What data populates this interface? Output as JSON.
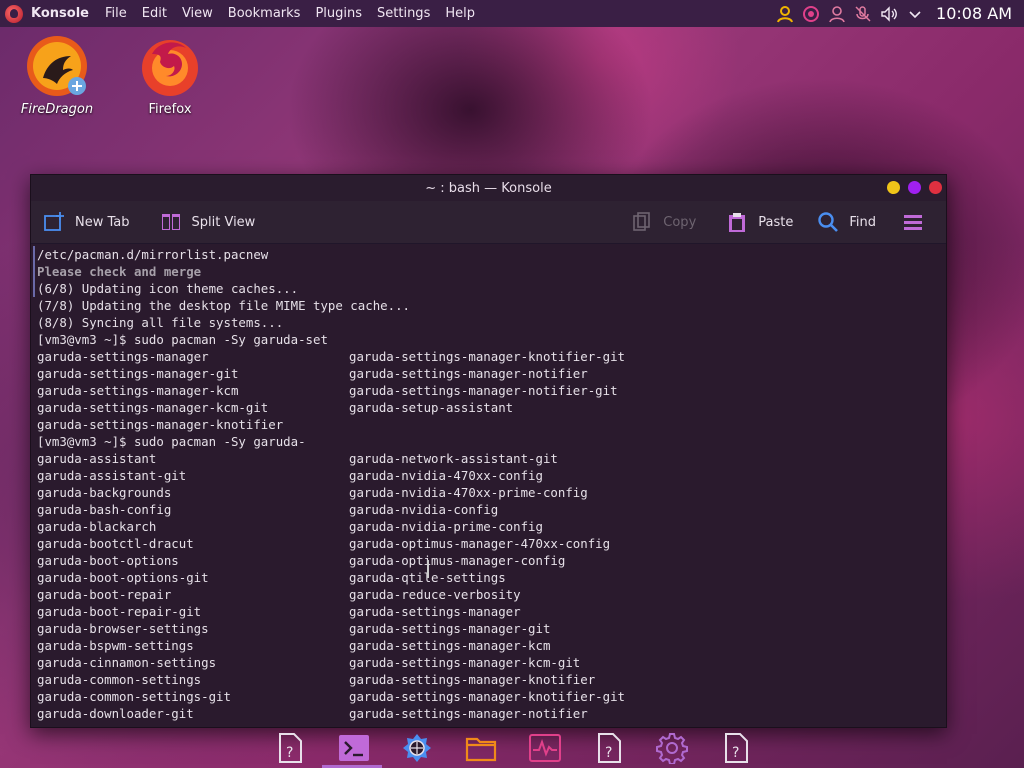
{
  "top_panel": {
    "app_name": "Konsole",
    "menu": [
      "File",
      "Edit",
      "View",
      "Bookmarks",
      "Plugins",
      "Settings",
      "Help"
    ],
    "clock": "10:08 AM"
  },
  "desktop": {
    "icons": [
      {
        "label": "FireDragon",
        "icon": "firedragon-icon"
      },
      {
        "label": "Firefox",
        "icon": "firefox-icon"
      }
    ]
  },
  "window": {
    "title": "~ : bash — Konsole",
    "toolbar": {
      "new_tab": "New Tab",
      "split_view": "Split View",
      "copy": "Copy",
      "paste": "Paste",
      "find": "Find"
    },
    "terminal": {
      "lines": [
        {
          "a": "/etc/pacman.d/mirrorlist.pacnew",
          "b": ""
        },
        {
          "a": "Please check and merge",
          "b": ""
        },
        {
          "a": "(6/8) Updating icon theme caches...",
          "b": ""
        },
        {
          "a": "(7/8) Updating the desktop file MIME type cache...",
          "b": ""
        },
        {
          "a": "(8/8) Syncing all file systems...",
          "b": ""
        },
        {
          "a": "[vm3@vm3 ~]$ sudo pacman -Sy garuda-set",
          "b": ""
        },
        {
          "a": "garuda-settings-manager",
          "b": "garuda-settings-manager-knotifier-git"
        },
        {
          "a": "garuda-settings-manager-git",
          "b": "garuda-settings-manager-notifier"
        },
        {
          "a": "garuda-settings-manager-kcm",
          "b": "garuda-settings-manager-notifier-git"
        },
        {
          "a": "garuda-settings-manager-kcm-git",
          "b": "garuda-setup-assistant"
        },
        {
          "a": "garuda-settings-manager-knotifier",
          "b": ""
        },
        {
          "a": "[vm3@vm3 ~]$ sudo pacman -Sy garuda-",
          "b": ""
        },
        {
          "a": "garuda-assistant",
          "b": "garuda-network-assistant-git"
        },
        {
          "a": "garuda-assistant-git",
          "b": "garuda-nvidia-470xx-config"
        },
        {
          "a": "garuda-backgrounds",
          "b": "garuda-nvidia-470xx-prime-config"
        },
        {
          "a": "garuda-bash-config",
          "b": "garuda-nvidia-config"
        },
        {
          "a": "garuda-blackarch",
          "b": "garuda-nvidia-prime-config"
        },
        {
          "a": "garuda-bootctl-dracut",
          "b": "garuda-optimus-manager-470xx-config"
        },
        {
          "a": "garuda-boot-options",
          "b": "garuda-optimus-manager-config"
        },
        {
          "a": "garuda-boot-options-git",
          "b": "garuda-qtile-settings"
        },
        {
          "a": "garuda-boot-repair",
          "b": "garuda-reduce-verbosity"
        },
        {
          "a": "garuda-boot-repair-git",
          "b": "garuda-settings-manager"
        },
        {
          "a": "garuda-browser-settings",
          "b": "garuda-settings-manager-git"
        },
        {
          "a": "garuda-bspwm-settings",
          "b": "garuda-settings-manager-kcm"
        },
        {
          "a": "garuda-cinnamon-settings",
          "b": "garuda-settings-manager-kcm-git"
        },
        {
          "a": "garuda-common-settings",
          "b": "garuda-settings-manager-knotifier"
        },
        {
          "a": "garuda-common-settings-git",
          "b": "garuda-settings-manager-knotifier-git"
        },
        {
          "a": "garuda-downloader-git",
          "b": "garuda-settings-manager-notifier"
        }
      ]
    }
  },
  "taskbar": [
    "document-icon",
    "terminal-icon",
    "network-tool-icon",
    "folder-icon",
    "system-monitor-icon",
    "document-icon",
    "settings-gear-icon",
    "document-icon"
  ],
  "colors": {
    "accent": "#b06ad0",
    "panel": "#3a1f45",
    "terminal_bg": "#2a1a2d"
  }
}
